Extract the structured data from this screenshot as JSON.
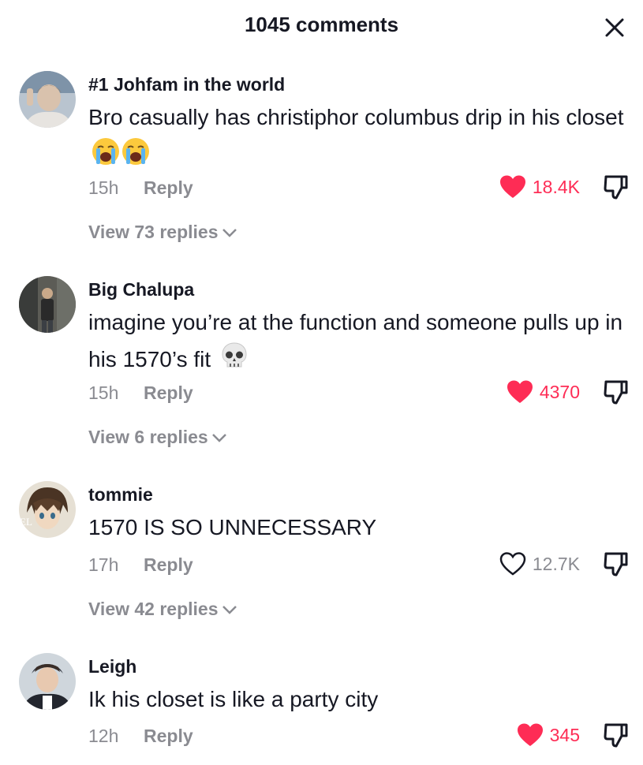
{
  "header": {
    "title": "1045 comments",
    "close_icon": "close-icon"
  },
  "colors": {
    "liked": "#fe2c55",
    "muted": "#8a8b91",
    "text": "#161823"
  },
  "comments": [
    {
      "username": "#1 Johfam in the world",
      "text": "Bro casually has christiphor columbus drip in his closet",
      "emoji": "crying-face-emoji",
      "time": "15h",
      "reply_label": "Reply",
      "likes": "18.4K",
      "liked": true,
      "view_replies": "View 73 replies"
    },
    {
      "username": "Big Chalupa",
      "text": "imagine you’re at the function and someone pulls up in his 1570’s fit",
      "emoji": "skull-emoji",
      "time": "15h",
      "reply_label": "Reply",
      "likes": "4370",
      "liked": true,
      "view_replies": "View 6 replies"
    },
    {
      "username": "tommie",
      "text": "1570 IS SO UNNECESSARY",
      "time": "17h",
      "reply_label": "Reply",
      "likes": "12.7K",
      "liked": false,
      "view_replies": "View 42 replies"
    },
    {
      "username": "Leigh",
      "text": "Ik his closet is like a party city",
      "time": "12h",
      "reply_label": "Reply",
      "likes": "345",
      "liked": true
    }
  ]
}
